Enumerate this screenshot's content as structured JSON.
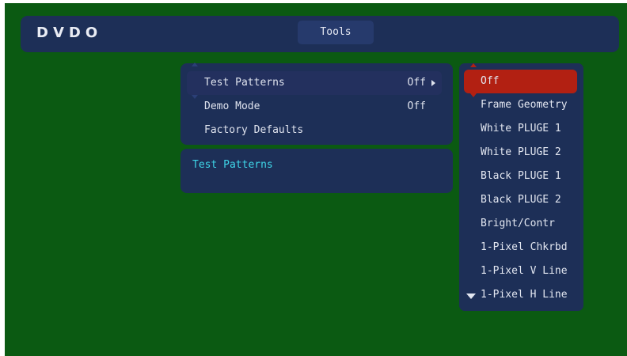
{
  "header": {
    "logo": "DVDO",
    "title": "Tools"
  },
  "menu": {
    "items": [
      {
        "label": "Test Patterns",
        "value": "Off"
      },
      {
        "label": "Demo Mode",
        "value": "Off"
      },
      {
        "label": "Factory Defaults",
        "value": ""
      }
    ],
    "selected_index": 0
  },
  "description": {
    "title": "Test Patterns"
  },
  "options": {
    "items": [
      "Off",
      "Frame Geometry",
      "White PLUGE 1",
      "White PLUGE 2",
      "Black PLUGE 1",
      "Black PLUGE 2",
      "Bright/Contr",
      "1-Pixel Chkrbd",
      "1-Pixel V Line",
      "1-Pixel H Line"
    ],
    "selected_index": 0
  },
  "colors": {
    "background": "#0b5a12",
    "panel": "#1d2f57",
    "highlight": "#b22012",
    "accent_text": "#3fd6e8"
  }
}
